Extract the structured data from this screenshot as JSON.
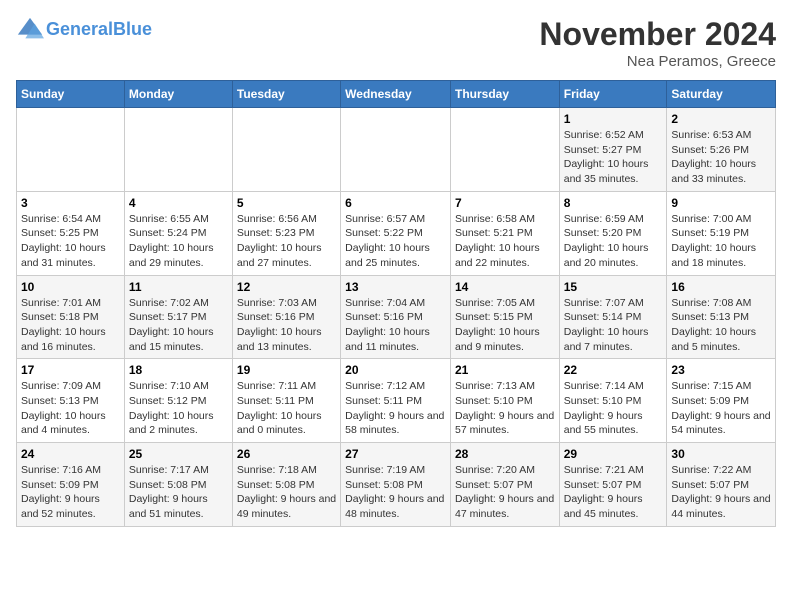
{
  "header": {
    "logo_line1": "General",
    "logo_line2": "Blue",
    "month": "November 2024",
    "location": "Nea Peramos, Greece"
  },
  "weekdays": [
    "Sunday",
    "Monday",
    "Tuesday",
    "Wednesday",
    "Thursday",
    "Friday",
    "Saturday"
  ],
  "weeks": [
    [
      {
        "day": "",
        "info": ""
      },
      {
        "day": "",
        "info": ""
      },
      {
        "day": "",
        "info": ""
      },
      {
        "day": "",
        "info": ""
      },
      {
        "day": "",
        "info": ""
      },
      {
        "day": "1",
        "info": "Sunrise: 6:52 AM\nSunset: 5:27 PM\nDaylight: 10 hours and 35 minutes."
      },
      {
        "day": "2",
        "info": "Sunrise: 6:53 AM\nSunset: 5:26 PM\nDaylight: 10 hours and 33 minutes."
      }
    ],
    [
      {
        "day": "3",
        "info": "Sunrise: 6:54 AM\nSunset: 5:25 PM\nDaylight: 10 hours and 31 minutes."
      },
      {
        "day": "4",
        "info": "Sunrise: 6:55 AM\nSunset: 5:24 PM\nDaylight: 10 hours and 29 minutes."
      },
      {
        "day": "5",
        "info": "Sunrise: 6:56 AM\nSunset: 5:23 PM\nDaylight: 10 hours and 27 minutes."
      },
      {
        "day": "6",
        "info": "Sunrise: 6:57 AM\nSunset: 5:22 PM\nDaylight: 10 hours and 25 minutes."
      },
      {
        "day": "7",
        "info": "Sunrise: 6:58 AM\nSunset: 5:21 PM\nDaylight: 10 hours and 22 minutes."
      },
      {
        "day": "8",
        "info": "Sunrise: 6:59 AM\nSunset: 5:20 PM\nDaylight: 10 hours and 20 minutes."
      },
      {
        "day": "9",
        "info": "Sunrise: 7:00 AM\nSunset: 5:19 PM\nDaylight: 10 hours and 18 minutes."
      }
    ],
    [
      {
        "day": "10",
        "info": "Sunrise: 7:01 AM\nSunset: 5:18 PM\nDaylight: 10 hours and 16 minutes."
      },
      {
        "day": "11",
        "info": "Sunrise: 7:02 AM\nSunset: 5:17 PM\nDaylight: 10 hours and 15 minutes."
      },
      {
        "day": "12",
        "info": "Sunrise: 7:03 AM\nSunset: 5:16 PM\nDaylight: 10 hours and 13 minutes."
      },
      {
        "day": "13",
        "info": "Sunrise: 7:04 AM\nSunset: 5:16 PM\nDaylight: 10 hours and 11 minutes."
      },
      {
        "day": "14",
        "info": "Sunrise: 7:05 AM\nSunset: 5:15 PM\nDaylight: 10 hours and 9 minutes."
      },
      {
        "day": "15",
        "info": "Sunrise: 7:07 AM\nSunset: 5:14 PM\nDaylight: 10 hours and 7 minutes."
      },
      {
        "day": "16",
        "info": "Sunrise: 7:08 AM\nSunset: 5:13 PM\nDaylight: 10 hours and 5 minutes."
      }
    ],
    [
      {
        "day": "17",
        "info": "Sunrise: 7:09 AM\nSunset: 5:13 PM\nDaylight: 10 hours and 4 minutes."
      },
      {
        "day": "18",
        "info": "Sunrise: 7:10 AM\nSunset: 5:12 PM\nDaylight: 10 hours and 2 minutes."
      },
      {
        "day": "19",
        "info": "Sunrise: 7:11 AM\nSunset: 5:11 PM\nDaylight: 10 hours and 0 minutes."
      },
      {
        "day": "20",
        "info": "Sunrise: 7:12 AM\nSunset: 5:11 PM\nDaylight: 9 hours and 58 minutes."
      },
      {
        "day": "21",
        "info": "Sunrise: 7:13 AM\nSunset: 5:10 PM\nDaylight: 9 hours and 57 minutes."
      },
      {
        "day": "22",
        "info": "Sunrise: 7:14 AM\nSunset: 5:10 PM\nDaylight: 9 hours and 55 minutes."
      },
      {
        "day": "23",
        "info": "Sunrise: 7:15 AM\nSunset: 5:09 PM\nDaylight: 9 hours and 54 minutes."
      }
    ],
    [
      {
        "day": "24",
        "info": "Sunrise: 7:16 AM\nSunset: 5:09 PM\nDaylight: 9 hours and 52 minutes."
      },
      {
        "day": "25",
        "info": "Sunrise: 7:17 AM\nSunset: 5:08 PM\nDaylight: 9 hours and 51 minutes."
      },
      {
        "day": "26",
        "info": "Sunrise: 7:18 AM\nSunset: 5:08 PM\nDaylight: 9 hours and 49 minutes."
      },
      {
        "day": "27",
        "info": "Sunrise: 7:19 AM\nSunset: 5:08 PM\nDaylight: 9 hours and 48 minutes."
      },
      {
        "day": "28",
        "info": "Sunrise: 7:20 AM\nSunset: 5:07 PM\nDaylight: 9 hours and 47 minutes."
      },
      {
        "day": "29",
        "info": "Sunrise: 7:21 AM\nSunset: 5:07 PM\nDaylight: 9 hours and 45 minutes."
      },
      {
        "day": "30",
        "info": "Sunrise: 7:22 AM\nSunset: 5:07 PM\nDaylight: 9 hours and 44 minutes."
      }
    ]
  ]
}
